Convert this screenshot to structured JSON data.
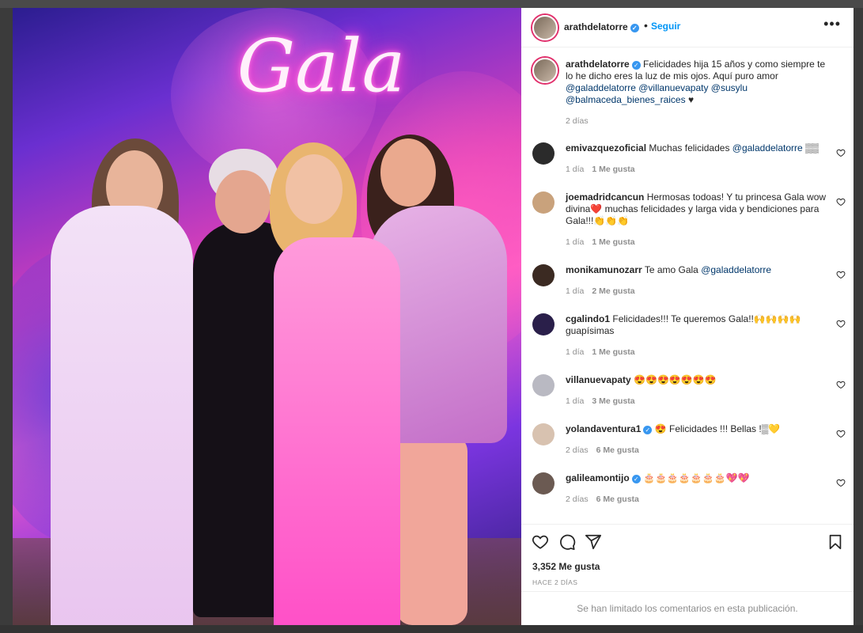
{
  "post": {
    "neon_sign": "Gala",
    "author": {
      "username": "arathdelatorre",
      "follow_label": "Seguir",
      "bullet": "•",
      "more_label": "•••"
    },
    "caption": {
      "username": "arathdelatorre",
      "text": "Felicidades hija 15 años y como siempre te lo he dicho eres la luz de mis ojos. Aquí puro amor ",
      "mentions": "@galaddelatorre @villanuevapaty @susylu @balmaceda_bienes_raices",
      "suffix": " ♥",
      "time": "2 días"
    },
    "comments": [
      {
        "username": "emivazquezoficial",
        "text": "Muchas felicidades ",
        "mention": "@galaddelatorre",
        "suffix": " ▒▒",
        "time": "1 día",
        "likes": "1 Me gusta",
        "avatar_color": "#2b2b2b"
      },
      {
        "username": "joemadridcancun",
        "text": "Hermosas todoas! Y tu princesa Gala wow divina❤️ muchas felicidades y larga vida y bendiciones para Gala!!!👏👏👏",
        "mention": "",
        "suffix": "",
        "time": "1 día",
        "likes": "1 Me gusta",
        "avatar_color": "#c9a27c"
      },
      {
        "username": "monikamunozarr",
        "text": "Te amo Gala ",
        "mention": "@galaddelatorre",
        "suffix": "",
        "time": "1 día",
        "likes": "2 Me gusta",
        "avatar_color": "#3b2a22"
      },
      {
        "username": "cgalindo1",
        "text": "Felicidades!!! Te queremos Gala!!🙌🙌🙌🙌 guapísimas",
        "mention": "",
        "suffix": "",
        "time": "1 día",
        "likes": "1 Me gusta",
        "avatar_color": "#2a1f4a"
      },
      {
        "username": "villanuevapaty",
        "text": "😍😍😍😍😍😍😍",
        "mention": "",
        "suffix": "",
        "time": "1 día",
        "likes": "3 Me gusta",
        "avatar_color": "#b9b9c2"
      },
      {
        "username": "yolandaventura1",
        "text": "😍 Felicidades !!! Bellas !▒💛",
        "mention": "",
        "suffix": "",
        "time": "2 días",
        "likes": "6 Me gusta",
        "avatar_color": "#d8c2b0",
        "verified": true
      },
      {
        "username": "galileamontijo",
        "text": "🎂🎂🎂🎂🎂🎂🎂💖💖",
        "mention": "",
        "suffix": "",
        "time": "2 días",
        "likes": "6 Me gusta",
        "avatar_color": "#6b5a52",
        "verified": true
      }
    ],
    "likes_count": "3,352 Me gusta",
    "timestamp": "HACE 2 DÍAS",
    "comments_limited": "Se han limitado los comentarios en esta publicación."
  },
  "colors": {
    "link": "#0095f6",
    "mention": "#00376b",
    "muted": "#8e8e8e",
    "verified": "#3897f0"
  }
}
